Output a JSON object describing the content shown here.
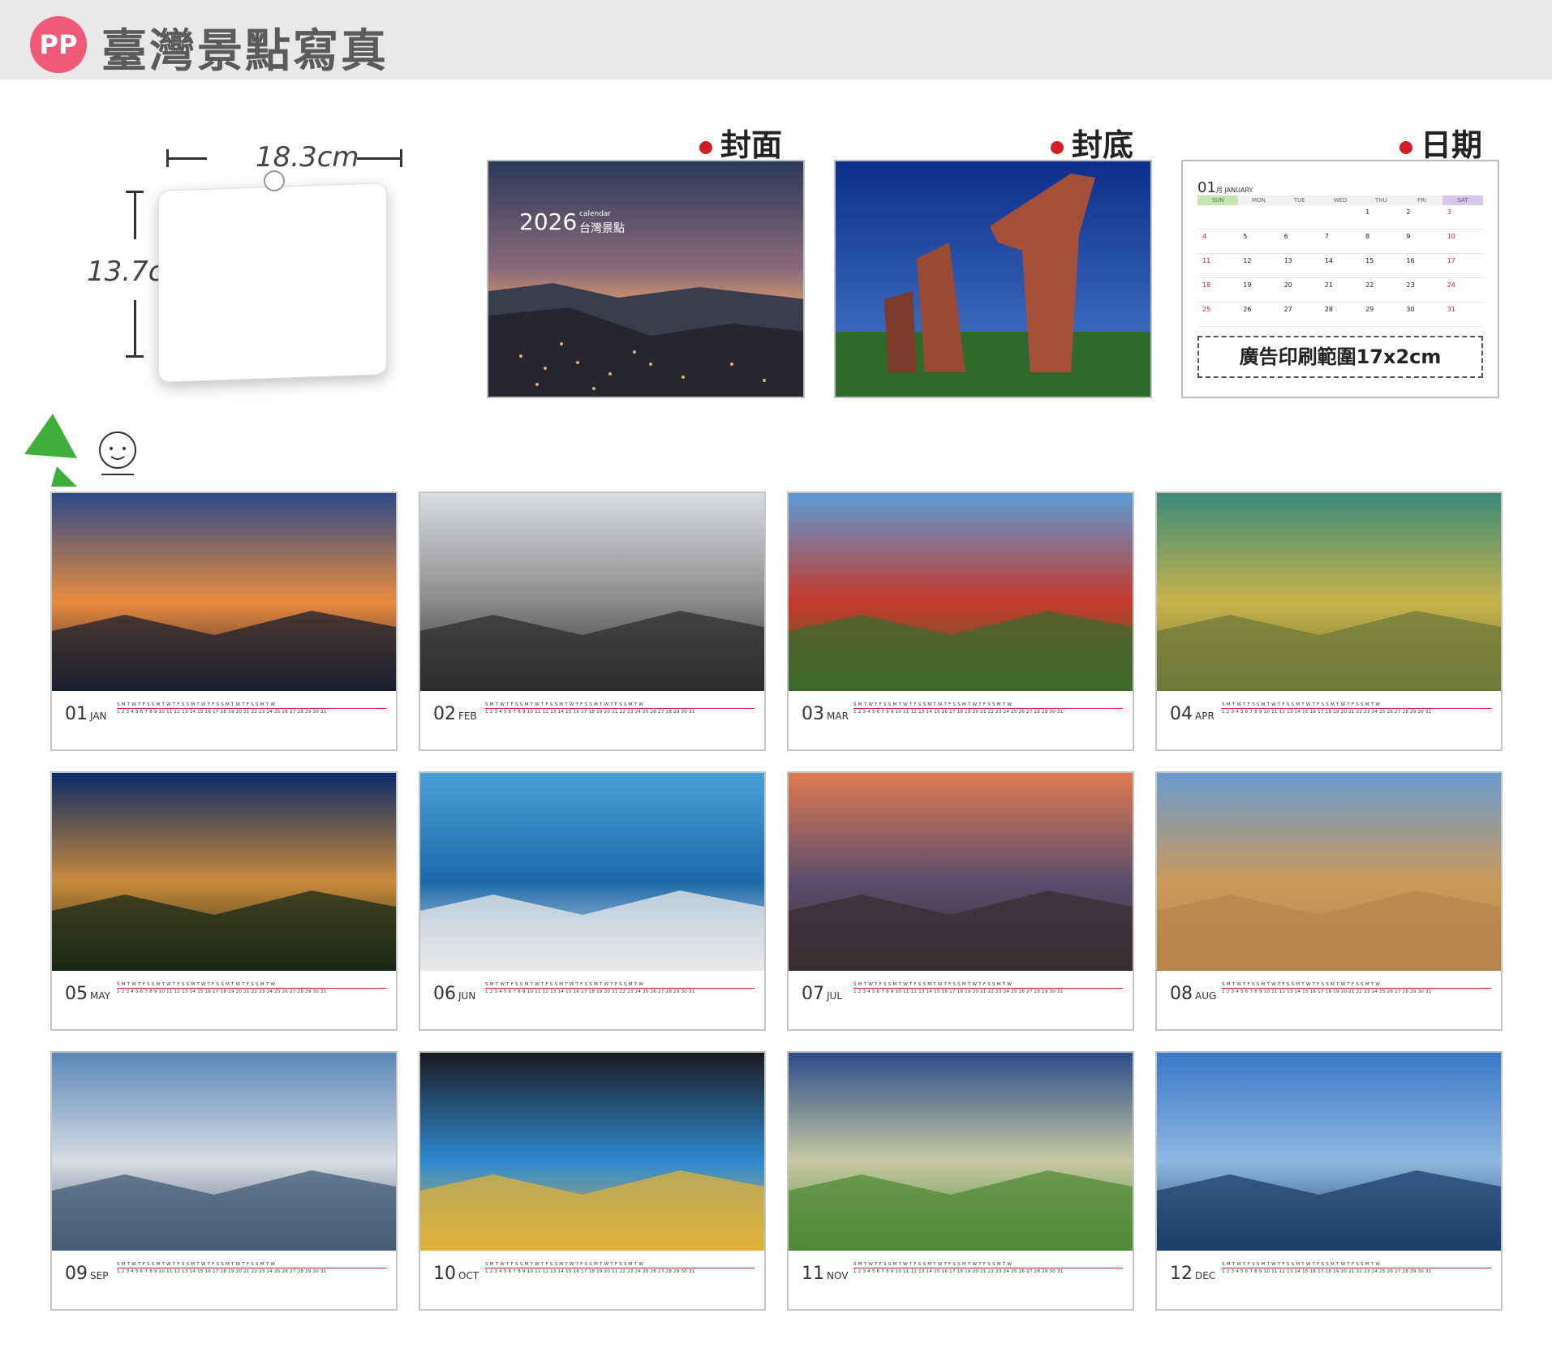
{
  "header": {
    "logo": "PP",
    "title": "臺灣景點寫真"
  },
  "size_sketch": {
    "width_label": "18.3cm",
    "height_label": "13.7cm"
  },
  "sections": {
    "cover": "封面",
    "back": "封底",
    "date": "日期"
  },
  "cover": {
    "year": "2026",
    "subtitle": "calendar",
    "name": "台灣景點"
  },
  "date_sample": {
    "month_num": "01",
    "month_small": "月 JANUARY",
    "weekdays": [
      "SUN",
      "MON",
      "TUE",
      "WED",
      "THU",
      "FRI",
      "SAT"
    ],
    "weeks": [
      [
        "",
        "",
        "",
        "",
        "1",
        "2",
        "3"
      ],
      [
        "4",
        "5",
        "6",
        "7",
        "8",
        "9",
        "10"
      ],
      [
        "11",
        "12",
        "13",
        "14",
        "15",
        "16",
        "17"
      ],
      [
        "18",
        "19",
        "20",
        "21",
        "22",
        "23",
        "24"
      ],
      [
        "25",
        "26",
        "27",
        "28",
        "29",
        "30",
        "31"
      ]
    ],
    "ad_text": "廣告印刷範圍17x2cm"
  },
  "months": [
    {
      "num": "01",
      "abbr": "JAN"
    },
    {
      "num": "02",
      "abbr": "FEB"
    },
    {
      "num": "03",
      "abbr": "MAR"
    },
    {
      "num": "04",
      "abbr": "APR"
    },
    {
      "num": "05",
      "abbr": "MAY"
    },
    {
      "num": "06",
      "abbr": "JUN"
    },
    {
      "num": "07",
      "abbr": "JUL"
    },
    {
      "num": "08",
      "abbr": "AUG"
    },
    {
      "num": "09",
      "abbr": "SEP"
    },
    {
      "num": "10",
      "abbr": "OCT"
    },
    {
      "num": "11",
      "abbr": "NOV"
    },
    {
      "num": "12",
      "abbr": "DEC"
    }
  ],
  "strip": {
    "days_31": "S M T W T F S S M T W T F S S M T W T F S S M T W T F S S M T W",
    "nums_31": "1 2 3 4 5 6 7 8 9 10 11 12 13 14 15 16 17 18 19 20 21 22 23 24 25 26 27 28 29 30 31"
  },
  "colors": {
    "accent_red": "#d31d27",
    "logo_pink": "#ef5a78",
    "header_bg": "#e9e9e9"
  }
}
